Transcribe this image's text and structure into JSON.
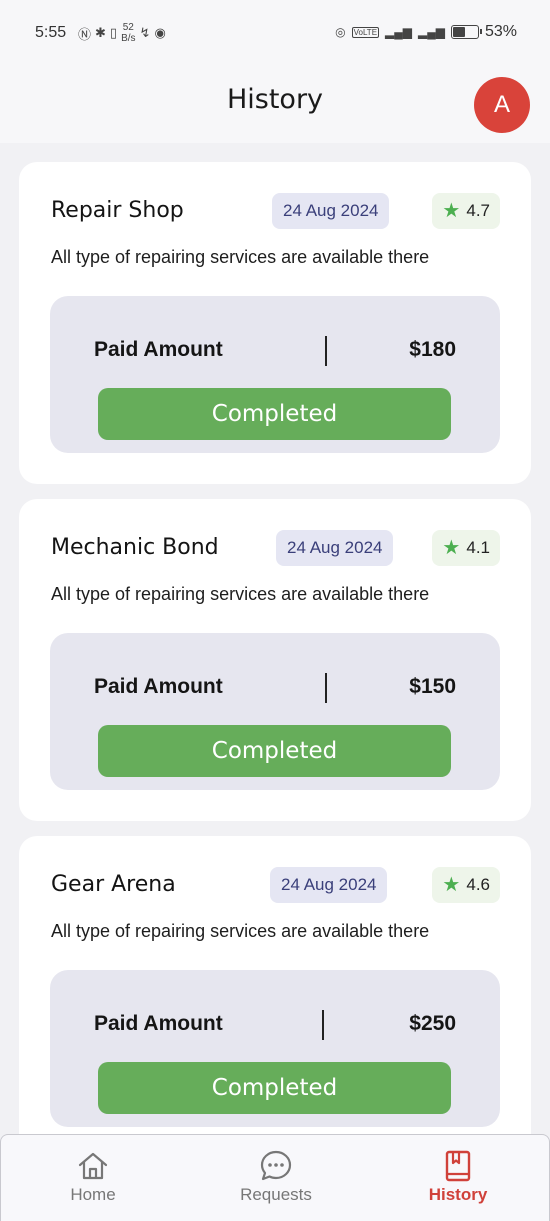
{
  "status_bar": {
    "time": "5:55",
    "net_speed_value": "52",
    "net_speed_unit": "B/s",
    "battery_percent": "53%",
    "battery_level": 0.53,
    "volte_label": "VoLTE"
  },
  "header": {
    "title": "History",
    "avatar_initial": "A",
    "avatar_color": "#d9433a"
  },
  "history": [
    {
      "name": "Repair Shop",
      "date": "24 Aug 2024",
      "rating": "4.7",
      "description": "All type of repairing services are available there",
      "paid_label": "Paid Amount",
      "amount": "$180",
      "status": "Completed"
    },
    {
      "name": "Mechanic Bond",
      "date": "24 Aug 2024",
      "rating": "4.1",
      "description": "All type of repairing services are available there",
      "paid_label": "Paid Amount",
      "amount": "$150",
      "status": "Completed"
    },
    {
      "name": "Gear Arena",
      "date": "24 Aug 2024",
      "rating": "4.6",
      "description": "All type of repairing services are available there",
      "paid_label": "Paid Amount",
      "amount": "$250",
      "status": "Completed"
    }
  ],
  "bottom_nav": {
    "items": [
      {
        "label": "Home",
        "icon": "home-icon",
        "active": false
      },
      {
        "label": "Requests",
        "icon": "chat-bubble-icon",
        "active": false
      },
      {
        "label": "History",
        "icon": "book-bookmark-icon",
        "active": true
      }
    ]
  },
  "colors": {
    "accent_active": "#d0413a",
    "completed_button": "#66ad5a",
    "star": "#4caf50"
  }
}
